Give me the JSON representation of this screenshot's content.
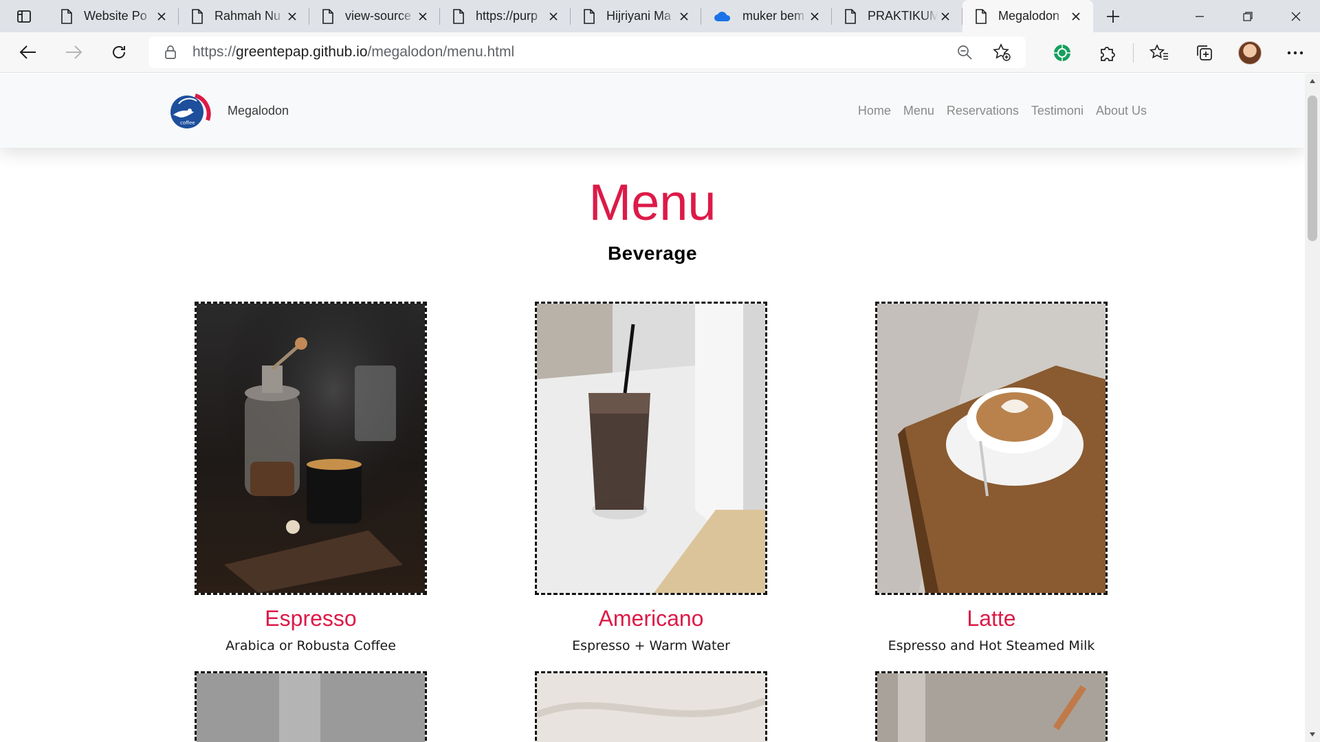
{
  "browser": {
    "tabs": [
      {
        "title": "Website Po",
        "icon": "page-icon"
      },
      {
        "title": "Rahmah Nu",
        "icon": "page-icon"
      },
      {
        "title": "view-source",
        "icon": "page-icon"
      },
      {
        "title": "https://purp",
        "icon": "page-icon"
      },
      {
        "title": "Hijriyani Ma",
        "icon": "page-icon"
      },
      {
        "title": "muker bem",
        "icon": "onedrive-icon"
      },
      {
        "title": "PRAKTIKUM",
        "icon": "page-icon"
      },
      {
        "title": "Megalodon",
        "icon": "page-icon"
      }
    ],
    "url_prefix": "https://",
    "url_host": "greentepap.github.io",
    "url_path": "/megalodon/menu.html"
  },
  "site": {
    "brand": "Megalodon",
    "logo_text": "MEGALODON",
    "logo_subtext": "coffee",
    "nav": [
      "Home",
      "Menu",
      "Reservations",
      "Testimoni",
      "About Us"
    ]
  },
  "page": {
    "title": "Menu",
    "section": "Beverage",
    "items": [
      {
        "name": "Espresso",
        "desc": "Arabica or Robusta Coffee"
      },
      {
        "name": "Americano",
        "desc": "Espresso + Warm Water"
      },
      {
        "name": "Latte",
        "desc": "Espresso and Hot Steamed Milk"
      }
    ]
  },
  "colors": {
    "accent": "#dc1a48",
    "tabstrip": "#dfe3e8",
    "toolbar": "#f7f7f7"
  }
}
